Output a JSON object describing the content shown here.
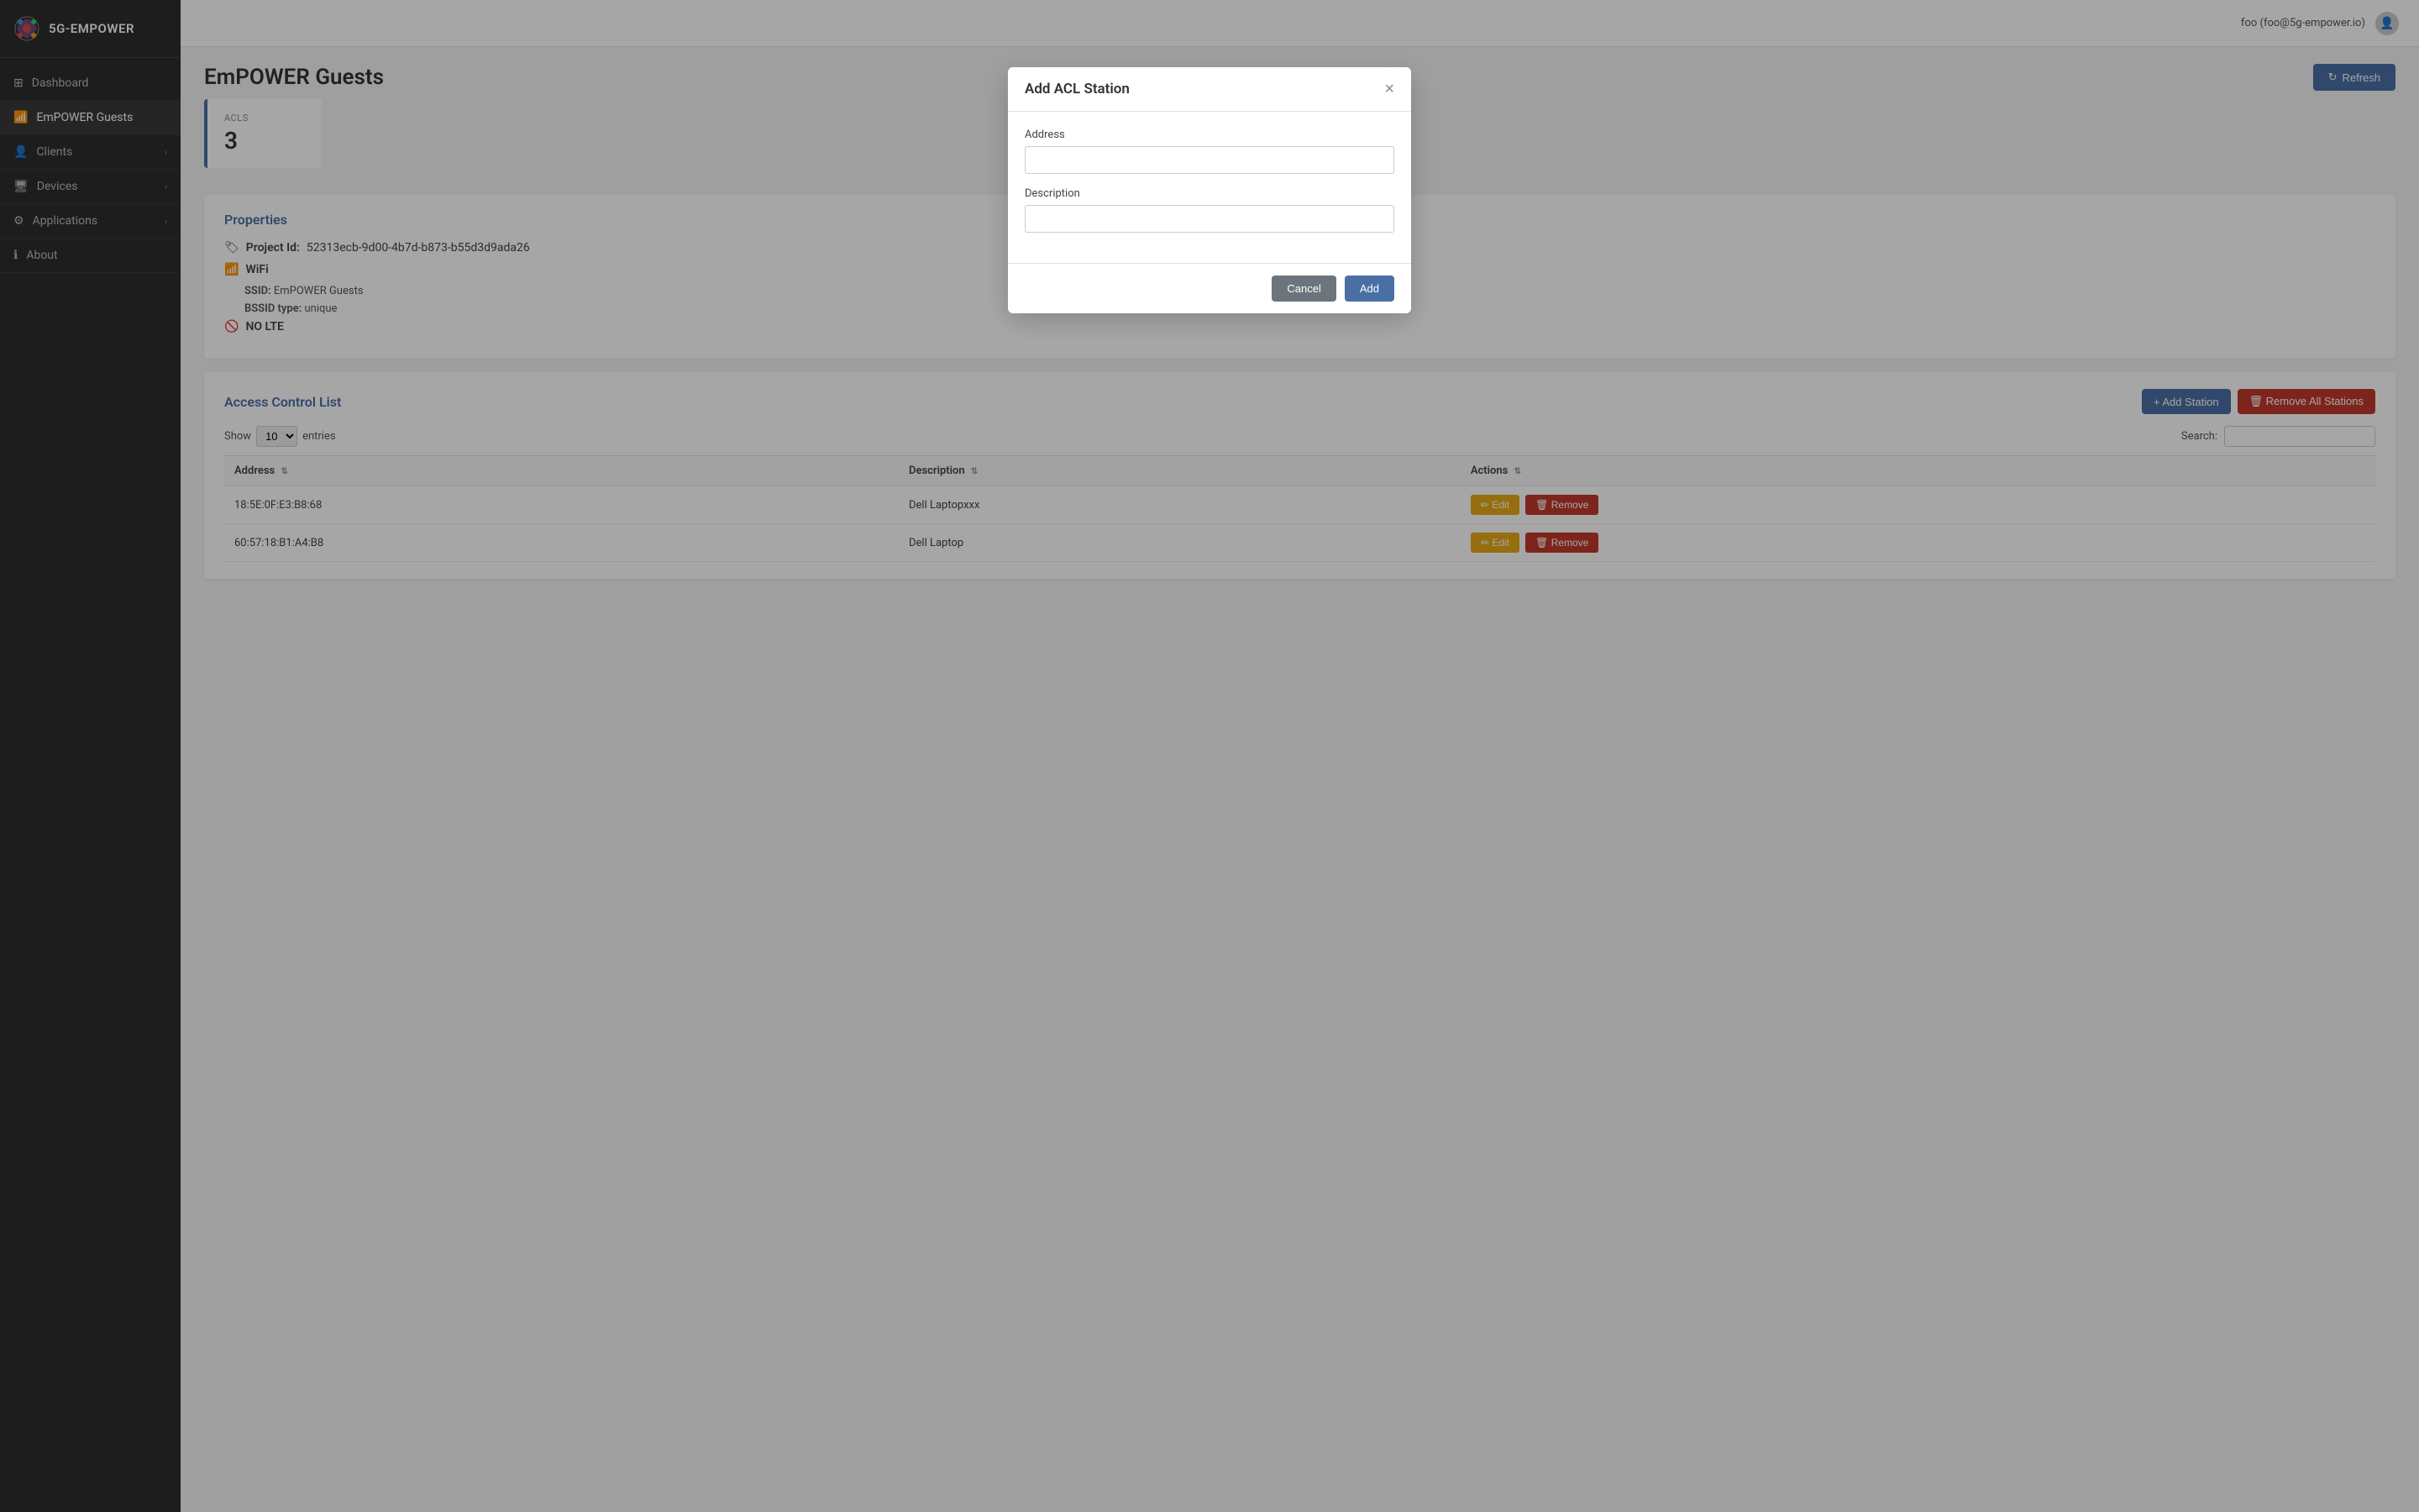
{
  "app": {
    "name": "5G-EMPOWER"
  },
  "topbar": {
    "user": "foo (foo@5g-empower.io)"
  },
  "sidebar": {
    "items": [
      {
        "id": "dashboard",
        "label": "Dashboard",
        "icon": "dashboard-icon",
        "hasChevron": false
      },
      {
        "id": "empower-guests",
        "label": "EmPOWER Guests",
        "icon": "wifi-icon",
        "hasChevron": false,
        "active": true
      },
      {
        "id": "clients",
        "label": "Clients",
        "icon": "clients-icon",
        "hasChevron": true
      },
      {
        "id": "devices",
        "label": "Devices",
        "icon": "devices-icon",
        "hasChevron": true
      },
      {
        "id": "applications",
        "label": "Applications",
        "icon": "applications-icon",
        "hasChevron": true
      },
      {
        "id": "about",
        "label": "About",
        "icon": "about-icon",
        "hasChevron": false
      }
    ]
  },
  "page": {
    "title": "EmPOWER Guests",
    "refresh_label": "Refresh"
  },
  "stats": {
    "acls_label": "ACLS",
    "acls_value": "3"
  },
  "properties": {
    "section_title": "Properties",
    "project_id_label": "Project Id:",
    "project_id_value": "52313ecb-9d00-4b7d-b873-b55d3d9ada26",
    "wifi_label": "WiFi",
    "ssid_label": "SSID:",
    "ssid_value": "EmPOWER Guests",
    "bssid_type_label": "BSSID type:",
    "bssid_type_value": "unique",
    "lte_label": "NO LTE"
  },
  "acl": {
    "section_title": "Access Control List",
    "add_station_label": "+ Add Station",
    "remove_all_label": "🗑 Remove All Stations",
    "show_label": "Show",
    "entries_label": "entries",
    "search_label": "Search:",
    "show_count": "10",
    "columns": [
      {
        "key": "address",
        "label": "Address"
      },
      {
        "key": "description",
        "label": "Description"
      },
      {
        "key": "actions",
        "label": "Actions"
      }
    ],
    "rows": [
      {
        "address": "18:5E:0F:E3:B8:68",
        "description": "Dell Laptopxxx"
      },
      {
        "address": "60:57:18:B1:A4:B8",
        "description": "Dell Laptop"
      }
    ],
    "edit_label": "✏ Edit",
    "remove_label": "🗑 Remove"
  },
  "modal": {
    "title": "Add ACL Station",
    "address_label": "Address",
    "address_placeholder": "",
    "description_label": "Description",
    "description_placeholder": "",
    "cancel_label": "Cancel",
    "add_label": "Add"
  }
}
